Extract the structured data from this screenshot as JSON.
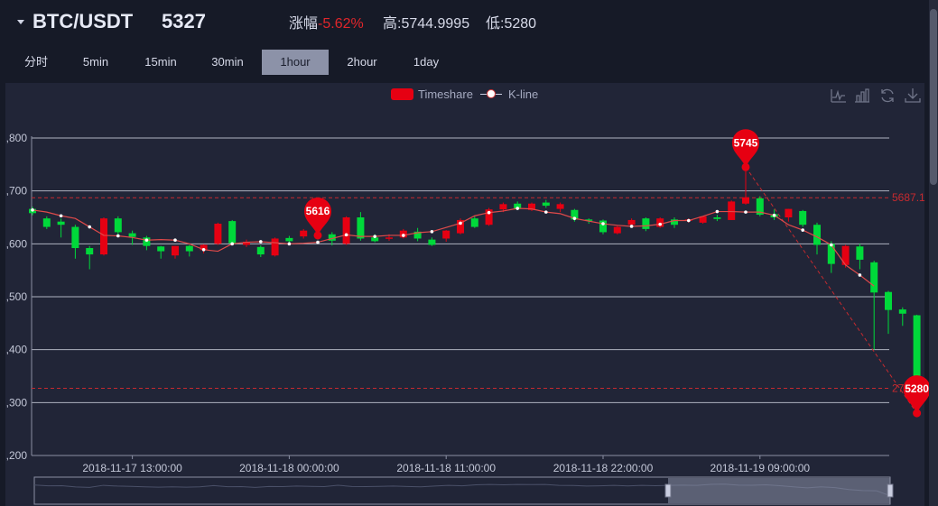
{
  "header": {
    "pair": "BTC/USDT",
    "last_price": "5327",
    "change_label": "涨幅",
    "change_value": "-5.62%",
    "high_label": "高:",
    "high_value": "5744.9995",
    "low_label": "低:",
    "low_value": "5280"
  },
  "tabs": [
    {
      "label": "分时",
      "active": false
    },
    {
      "label": "5min",
      "active": false
    },
    {
      "label": "15min",
      "active": false
    },
    {
      "label": "30min",
      "active": false
    },
    {
      "label": "1hour",
      "active": true
    },
    {
      "label": "2hour",
      "active": false
    },
    {
      "label": "1day",
      "active": false
    }
  ],
  "legend": [
    "Timeshare",
    "K-line"
  ],
  "colors": {
    "up": "#e60012",
    "down": "#00d93a",
    "ma": "#e04a4a",
    "grid": "#c8ccd8",
    "markline": "#c62a2f",
    "background": "#212537"
  },
  "tool_icons": [
    "line-chart-icon",
    "bar-chart-icon",
    "refresh-icon",
    "download-icon"
  ],
  "chart_data": {
    "type": "candlestick",
    "ylim": [
      5200,
      5800
    ],
    "y_ticks": [
      5200,
      5300,
      5400,
      5500,
      5600,
      5700,
      5800
    ],
    "y_tick_labels": [
      ",200",
      ",300",
      ",400",
      ",500",
      ",600",
      ",700",
      ",800"
    ],
    "x_labels": [
      {
        "index": 7,
        "label": "2018-11-17 13:00:00"
      },
      {
        "index": 18,
        "label": "2018-11-18 00:00:00"
      },
      {
        "index": 29,
        "label": "2018-11-18 11:00:00"
      },
      {
        "index": 40,
        "label": "2018-11-18 22:00:00"
      },
      {
        "index": 51,
        "label": "2018-11-19 09:00:00"
      }
    ],
    "candles": [
      [
        5666,
        5658,
        5670,
        5654
      ],
      [
        5648,
        5632,
        5652,
        5628
      ],
      [
        5642,
        5636,
        5648,
        5612
      ],
      [
        5632,
        5592,
        5636,
        5572
      ],
      [
        5592,
        5580,
        5596,
        5552
      ],
      [
        5580,
        5648,
        5650,
        5578
      ],
      [
        5648,
        5622,
        5652,
        5618
      ],
      [
        5620,
        5613,
        5625,
        5598
      ],
      [
        5612,
        5596,
        5615,
        5588
      ],
      [
        5595,
        5586,
        5596,
        5572
      ],
      [
        5578,
        5596,
        5596,
        5572
      ],
      [
        5596,
        5586,
        5598,
        5576
      ],
      [
        5588,
        5598,
        5599,
        5582
      ],
      [
        5600,
        5638,
        5640,
        5598
      ],
      [
        5643,
        5601,
        5645,
        5598
      ],
      [
        5598,
        5604,
        5608,
        5594
      ],
      [
        5594,
        5580,
        5597,
        5575
      ],
      [
        5578,
        5610,
        5612,
        5576
      ],
      [
        5611,
        5605,
        5615,
        5602
      ],
      [
        5614,
        5625,
        5628,
        5610
      ],
      [
        5618,
        5613,
        5620,
        5608
      ],
      [
        5618,
        5606,
        5622,
        5597
      ],
      [
        5600,
        5650,
        5652,
        5598
      ],
      [
        5650,
        5610,
        5660,
        5606
      ],
      [
        5612,
        5605,
        5618,
        5603
      ],
      [
        5610,
        5612,
        5618,
        5606
      ],
      [
        5612,
        5625,
        5628,
        5610
      ],
      [
        5623,
        5610,
        5630,
        5605
      ],
      [
        5608,
        5598,
        5612,
        5596
      ],
      [
        5610,
        5625,
        5626,
        5604
      ],
      [
        5620,
        5645,
        5648,
        5618
      ],
      [
        5648,
        5632,
        5652,
        5630
      ],
      [
        5636,
        5665,
        5668,
        5634
      ],
      [
        5665,
        5675,
        5678,
        5660
      ],
      [
        5676,
        5666,
        5680,
        5664
      ],
      [
        5664,
        5676,
        5678,
        5662
      ],
      [
        5678,
        5672,
        5683,
        5668
      ],
      [
        5666,
        5675,
        5678,
        5660
      ],
      [
        5664,
        5646,
        5666,
        5642
      ],
      [
        5646,
        5644,
        5648,
        5638
      ],
      [
        5644,
        5622,
        5646,
        5618
      ],
      [
        5620,
        5632,
        5634,
        5618
      ],
      [
        5636,
        5645,
        5648,
        5634
      ],
      [
        5648,
        5628,
        5650,
        5624
      ],
      [
        5632,
        5648,
        5650,
        5630
      ],
      [
        5646,
        5636,
        5650,
        5630
      ],
      [
        5644,
        5646,
        5648,
        5640
      ],
      [
        5640,
        5652,
        5652,
        5638
      ],
      [
        5650,
        5647,
        5655,
        5643
      ],
      [
        5645,
        5680,
        5682,
        5645
      ],
      [
        5676,
        5688,
        5745,
        5674
      ],
      [
        5686,
        5655,
        5690,
        5652
      ],
      [
        5656,
        5650,
        5665,
        5645
      ],
      [
        5650,
        5666,
        5666,
        5642
      ],
      [
        5662,
        5636,
        5664,
        5632
      ],
      [
        5636,
        5598,
        5640,
        5580
      ],
      [
        5600,
        5562,
        5605,
        5545
      ],
      [
        5560,
        5596,
        5598,
        5555
      ],
      [
        5595,
        5570,
        5600,
        5552
      ],
      [
        5565,
        5508,
        5568,
        5400
      ],
      [
        5509,
        5475,
        5511,
        5430
      ],
      [
        5476,
        5468,
        5480,
        5445
      ],
      [
        5465,
        5300,
        5466,
        5280
      ]
    ],
    "ma": [
      5664,
      5660,
      5653,
      5648,
      5632,
      5616,
      5615,
      5612,
      5607,
      5608,
      5607,
      5600,
      5589,
      5586,
      5600,
      5603,
      5604,
      5602,
      5600,
      5601,
      5603,
      5610,
      5617,
      5614,
      5614,
      5616,
      5616,
      5621,
      5623,
      5631,
      5639,
      5653,
      5659,
      5662,
      5667,
      5666,
      5660,
      5657,
      5648,
      5643,
      5638,
      5635,
      5633,
      5634,
      5637,
      5644,
      5644,
      5652,
      5661,
      5661,
      5660,
      5660,
      5654,
      5636,
      5626,
      5613,
      5598,
      5560,
      5541,
      5520
    ],
    "markers": [
      {
        "label": "5616",
        "index": 20,
        "value": 5616
      },
      {
        "label": "5745",
        "index": 50,
        "value": 5745
      },
      {
        "label": "5280",
        "index": 62,
        "value": 5280
      }
    ],
    "marklines": [
      {
        "label": "5687.1",
        "value": 5687.1
      },
      {
        "label": "27",
        "value": 5327
      }
    ]
  }
}
